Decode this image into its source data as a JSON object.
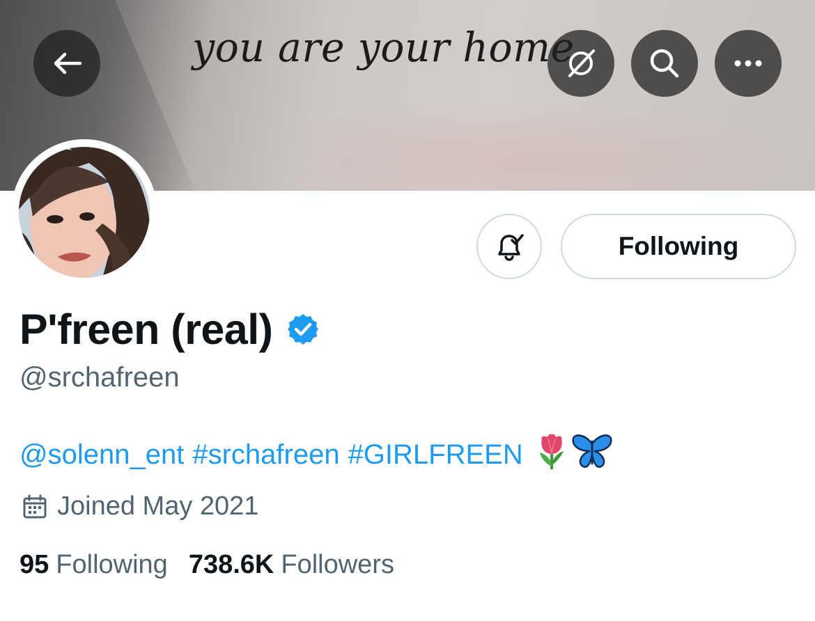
{
  "banner": {
    "quote": "you are your home"
  },
  "header_buttons": {
    "back": "arrow-left-icon",
    "grok": "grok-icon",
    "search": "search-icon",
    "more": "more-icon"
  },
  "profile": {
    "name": "P'freen (real)",
    "handle": "@srchafreen",
    "bio_links": [
      "@solenn_ent",
      "#srchafreen",
      "#GIRLFREEN"
    ],
    "bio_emojis": [
      "tulip-emoji",
      "butterfly-emoji"
    ],
    "joined": "Joined May 2021",
    "following_count": "95",
    "following_label": "Following",
    "followers_count": "738.6K",
    "followers_label": "Followers"
  },
  "actions": {
    "follow_button": "Following",
    "notify": "bell-check-icon"
  },
  "colors": {
    "accent": "#1d9bf0",
    "text": "#0f1419",
    "muted": "#536471",
    "border": "#cfd9de"
  }
}
